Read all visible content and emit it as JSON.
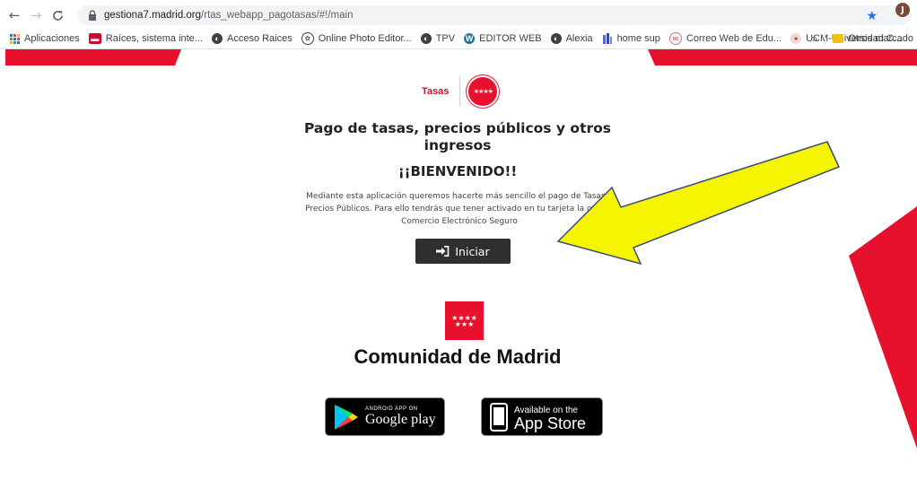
{
  "browser": {
    "url_host": "gestiona7.madrid.org",
    "url_path": "/rtas_webapp_pagotasas/#!/main",
    "profile_initial": "J",
    "bookmarks": [
      {
        "label": "Aplicaciones",
        "icon": "apps-grid-icon"
      },
      {
        "label": "Raíces, sistema inte...",
        "icon": "raices-favicon"
      },
      {
        "label": "Acceso Raices",
        "icon": "globe-icon"
      },
      {
        "label": "Online Photo Editor...",
        "icon": "photo-editor-favicon"
      },
      {
        "label": "TPV",
        "icon": "globe-icon"
      },
      {
        "label": "EDITOR WEB",
        "icon": "wordpress-icon"
      },
      {
        "label": "Alexia",
        "icon": "globe-icon"
      },
      {
        "label": "home sup",
        "icon": "bar-chart-favicon"
      },
      {
        "label": "Correo Web de Edu...",
        "icon": "mail-favicon"
      },
      {
        "label": "UCM-Universidad C...",
        "icon": "ucm-favicon"
      }
    ],
    "bookmarks_overflow": "»",
    "other_bookmarks": "Otros marcado"
  },
  "page": {
    "logo_text": "Tasas",
    "title": "Pago de tasas, precios públicos y otros ingresos",
    "welcome": "¡¡BIENVENIDO!!",
    "description_line1": "Mediante esta aplicación queremos hacerte más sencillo el pago de Tasas y",
    "description_line2": "Precios Públicos. Para ello tendrás que tener activado en tu tarjeta la opción",
    "description_line3": "Comercio Electrónico Seguro",
    "start_button": "Iniciar",
    "org_name": "Comunidad de Madrid",
    "google_play_small": "ANDROID APP ON",
    "google_play_big": "Google play",
    "app_store_small": "Available on the",
    "app_store_big": "App Store"
  },
  "colors": {
    "brand_red": "#e8112d",
    "arrow_fill": "#f5f500",
    "button_dark": "#2f2f2f"
  }
}
